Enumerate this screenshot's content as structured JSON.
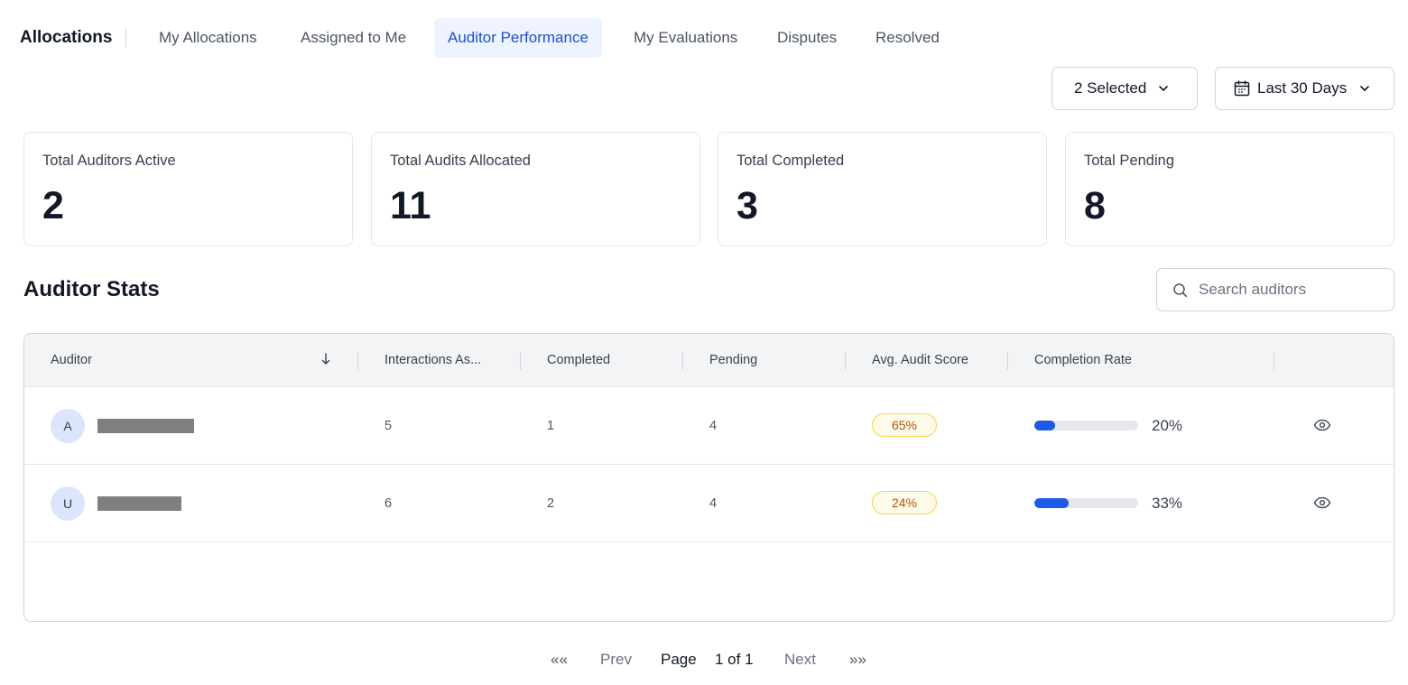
{
  "nav": {
    "brand": "Allocations",
    "tabs": [
      {
        "label": "My Allocations",
        "active": false
      },
      {
        "label": "Assigned to Me",
        "active": false
      },
      {
        "label": "Auditor Performance",
        "active": true
      },
      {
        "label": "My Evaluations",
        "active": false
      },
      {
        "label": "Disputes",
        "active": false
      },
      {
        "label": "Resolved",
        "active": false
      }
    ]
  },
  "filters": {
    "selection": "2 Selected",
    "date_range": "Last 30 Days"
  },
  "stats": [
    {
      "label": "Total Auditors Active",
      "value": "2"
    },
    {
      "label": "Total Audits Allocated",
      "value": "11"
    },
    {
      "label": "Total Completed",
      "value": "3"
    },
    {
      "label": "Total Pending",
      "value": "8"
    }
  ],
  "section": {
    "title": "Auditor Stats",
    "search_placeholder": "Search auditors"
  },
  "table": {
    "columns": [
      "Auditor",
      "Interactions As...",
      "Completed",
      "Pending",
      "Avg. Audit Score",
      "Completion Rate"
    ],
    "sort_icon": "arrow-down-icon",
    "rows": [
      {
        "initial": "A",
        "interactions": "5",
        "completed": "1",
        "pending": "4",
        "score": "65%",
        "rate_label": "20%",
        "rate": 0.2
      },
      {
        "initial": "U",
        "interactions": "6",
        "completed": "2",
        "pending": "4",
        "score": "24%",
        "rate_label": "33%",
        "rate": 0.33
      }
    ]
  },
  "pagination": {
    "first": "««",
    "prev": "Prev",
    "page_label": "Page",
    "page_value": "1 of 1",
    "next": "Next",
    "last": "»»"
  },
  "colors": {
    "accent": "#1d4ed8",
    "progress": "#1d5ae8",
    "badge_text": "#b45309",
    "badge_border": "#fcd34d"
  }
}
